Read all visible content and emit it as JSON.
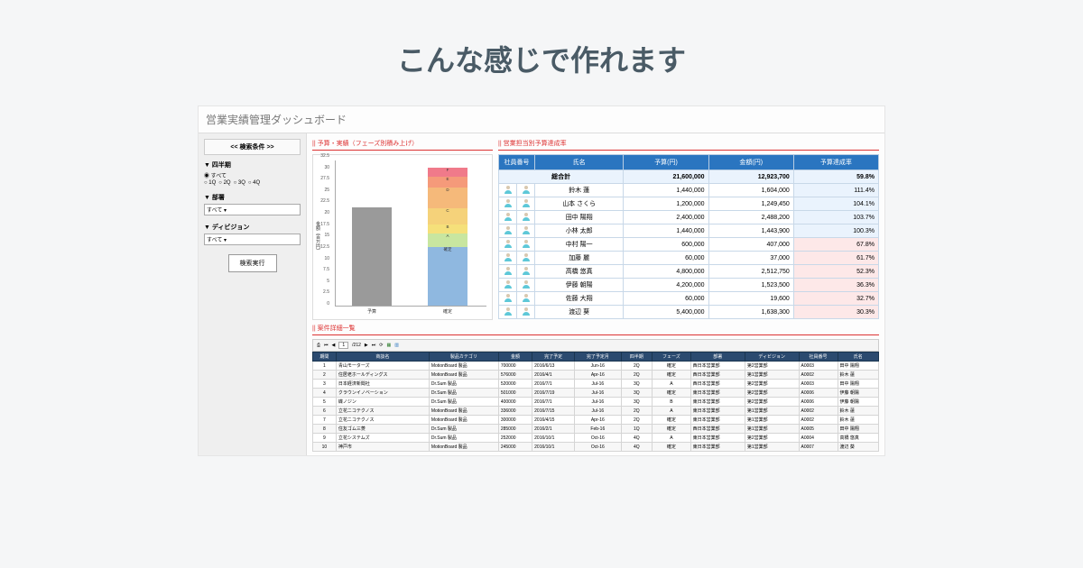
{
  "page_title": "こんな感じで作れます",
  "app_title": "営業実績管理ダッシュボード",
  "sidebar": {
    "header": "<< 検索条件 >>",
    "groups": [
      {
        "label": "▼ 四半期",
        "type": "radio",
        "options": [
          "すべて",
          "1Q",
          "2Q",
          "3Q",
          "4Q"
        ],
        "selected": 0
      },
      {
        "label": "▼ 部署",
        "type": "select",
        "value": "すべて"
      },
      {
        "label": "▼ ディビジョン",
        "type": "select",
        "value": "すべて"
      }
    ],
    "search_button": "検索実行"
  },
  "chart_section_title": "|| 予算・実績（フェーズ別積み上げ）",
  "budget_section_title": "|| 営業担当別予算達成率",
  "detail_section_title": "|| 案件詳細一覧",
  "budget_table": {
    "headers": [
      "社員番号",
      "氏名",
      "予算(円)",
      "金額(円)",
      "予算達成率"
    ],
    "total_label": "総合計",
    "total": {
      "budget": "21,600,000",
      "amount": "12,923,700",
      "rate": "59.8%"
    },
    "rows": [
      {
        "name": "鈴木 蓮",
        "budget": "1,440,000",
        "amount": "1,604,000",
        "rate": "111.4%",
        "good": true
      },
      {
        "name": "山本 さくら",
        "budget": "1,200,000",
        "amount": "1,249,450",
        "rate": "104.1%",
        "good": true
      },
      {
        "name": "田中 陽翔",
        "budget": "2,400,000",
        "amount": "2,488,200",
        "rate": "103.7%",
        "good": true
      },
      {
        "name": "小林 太郎",
        "budget": "1,440,000",
        "amount": "1,443,900",
        "rate": "100.3%",
        "good": true
      },
      {
        "name": "中村 陽一",
        "budget": "600,000",
        "amount": "407,000",
        "rate": "67.8%",
        "good": false
      },
      {
        "name": "加藤 麗",
        "budget": "60,000",
        "amount": "37,000",
        "rate": "61.7%",
        "good": false
      },
      {
        "name": "高橋 悠真",
        "budget": "4,800,000",
        "amount": "2,512,750",
        "rate": "52.3%",
        "good": false
      },
      {
        "name": "伊藤 朝陽",
        "budget": "4,200,000",
        "amount": "1,523,500",
        "rate": "36.3%",
        "good": false
      },
      {
        "name": "佐藤 大翔",
        "budget": "60,000",
        "amount": "19,600",
        "rate": "32.7%",
        "good": false
      },
      {
        "name": "渡辺 葵",
        "budget": "5,400,000",
        "amount": "1,638,300",
        "rate": "30.3%",
        "good": false
      }
    ]
  },
  "detail_table": {
    "toolbar": {
      "page_current": "1",
      "page_total": "/212"
    },
    "headers": [
      "期間",
      "商談名",
      "製品カテゴリ",
      "金額",
      "完了予定",
      "完了予定月",
      "四半期",
      "フェーズ",
      "部署",
      "ディビジョン",
      "社員番号",
      "氏名"
    ],
    "rows": [
      [
        "1",
        "青山モーターズ",
        "MotionBoard 製品",
        "700000",
        "2016/6/13",
        "Jun-16",
        "2Q",
        "確定",
        "西日本営業部",
        "第2営業部",
        "A0003",
        "田中 陽翔"
      ],
      [
        "2",
        "住居老ホールディングス",
        "MotionBoard 製品",
        "576000",
        "2016/4/1",
        "Apr-16",
        "2Q",
        "確定",
        "西日本営業部",
        "第1営業部",
        "A0002",
        "鈴木 蓮"
      ],
      [
        "3",
        "日本経済新聞社",
        "Dr.Sum 製品",
        "520000",
        "2016/7/1",
        "Jul-16",
        "3Q",
        "A",
        "西日本営業部",
        "第2営業部",
        "A0003",
        "田中 陽翔"
      ],
      [
        "4",
        "クラウンイノベーション",
        "Dr.Sum 製品",
        "501000",
        "2016/7/19",
        "Jul-16",
        "3Q",
        "確定",
        "東日本営業部",
        "第2営業部",
        "A0006",
        "伊藤 朝陽"
      ],
      [
        "5",
        "蝶ノジン",
        "Dr.Sum 製品",
        "400000",
        "2016/7/1",
        "Jul-16",
        "3Q",
        "B",
        "東日本営業部",
        "第2営業部",
        "A0006",
        "伊藤 朝陽"
      ],
      [
        "6",
        "立花ニコテクノス",
        "MotionBoard 製品",
        "336000",
        "2016/7/15",
        "Jul-16",
        "2Q",
        "A",
        "東日本営業部",
        "第1営業部",
        "A0002",
        "鈴木 蓮"
      ],
      [
        "7",
        "立花ニコテクノス",
        "MotionBoard 製品",
        "300000",
        "2016/4/15",
        "Apr-16",
        "2Q",
        "確定",
        "東日本営業部",
        "第1営業部",
        "A0002",
        "鈴木 蓮"
      ],
      [
        "8",
        "住友ゴム三菱",
        "Dr.Sum 製品",
        "285000",
        "2016/2/1",
        "Feb-16",
        "1Q",
        "確定",
        "西日本営業部",
        "第1営業部",
        "A0005",
        "田中 陽翔"
      ],
      [
        "9",
        "立花システムズ",
        "Dr.Sum 製品",
        "252000",
        "2016/10/1",
        "Oct-16",
        "4Q",
        "A",
        "東日本営業部",
        "第2営業部",
        "A0004",
        "高橋 悠真"
      ],
      [
        "10",
        "神戸市",
        "MotionBoard 製品",
        "245000",
        "2016/10/1",
        "Oct-16",
        "4Q",
        "確定",
        "東日本営業部",
        "第1営業部",
        "A0007",
        "渡辺 葵"
      ]
    ]
  },
  "chart_data": {
    "type": "bar",
    "title": "予算・実績（フェーズ別積み上げ）",
    "ylabel": "金額（百万円）",
    "ylim": [
      0,
      32.5
    ],
    "yticks": [
      0,
      2.5,
      5,
      7.5,
      10,
      12.5,
      15,
      17.5,
      20,
      22.5,
      25,
      27.5,
      30,
      32.5
    ],
    "categories": [
      "予算",
      "確定"
    ],
    "series_stack_on_actual": [
      {
        "name": "確定",
        "value": 12.9,
        "color": "#8fb8e0"
      },
      {
        "name": "A",
        "value": 3.0,
        "color": "#c8e6a0"
      },
      {
        "name": "B",
        "value": 2.0,
        "color": "#f5e07a"
      },
      {
        "name": "C",
        "value": 3.5,
        "color": "#f5d27a"
      },
      {
        "name": "D",
        "value": 4.5,
        "color": "#f5b97a"
      },
      {
        "name": "E",
        "value": 2.5,
        "color": "#f59a7a"
      },
      {
        "name": "F",
        "value": 2.0,
        "color": "#f07a8a"
      }
    ],
    "budget_total": 21.6
  }
}
